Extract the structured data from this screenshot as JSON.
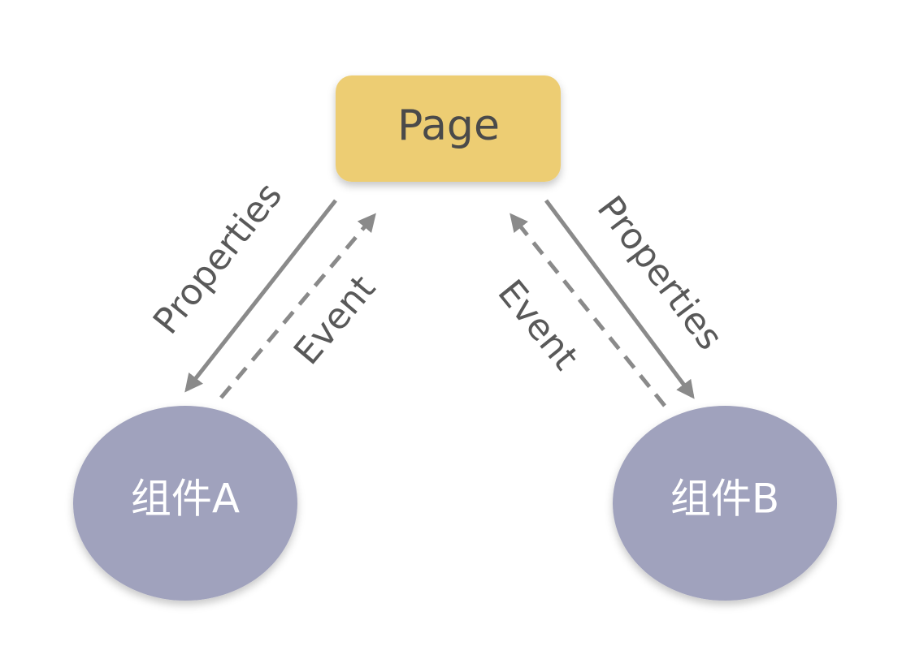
{
  "nodes": {
    "page": {
      "label": "Page"
    },
    "component_a": {
      "label": "组件A"
    },
    "component_b": {
      "label": "组件B"
    }
  },
  "edges": {
    "left_properties": {
      "label": "Properties"
    },
    "left_event": {
      "label": "Event"
    },
    "right_properties": {
      "label": "Properties"
    },
    "right_event": {
      "label": "Event"
    }
  },
  "colors": {
    "page_fill": "#EDCD73",
    "component_fill": "#A0A2BD",
    "arrow": "#8A8A8A",
    "page_text": "#4A4A4A",
    "component_text": "#FFFFFF",
    "label_text": "#595959"
  }
}
